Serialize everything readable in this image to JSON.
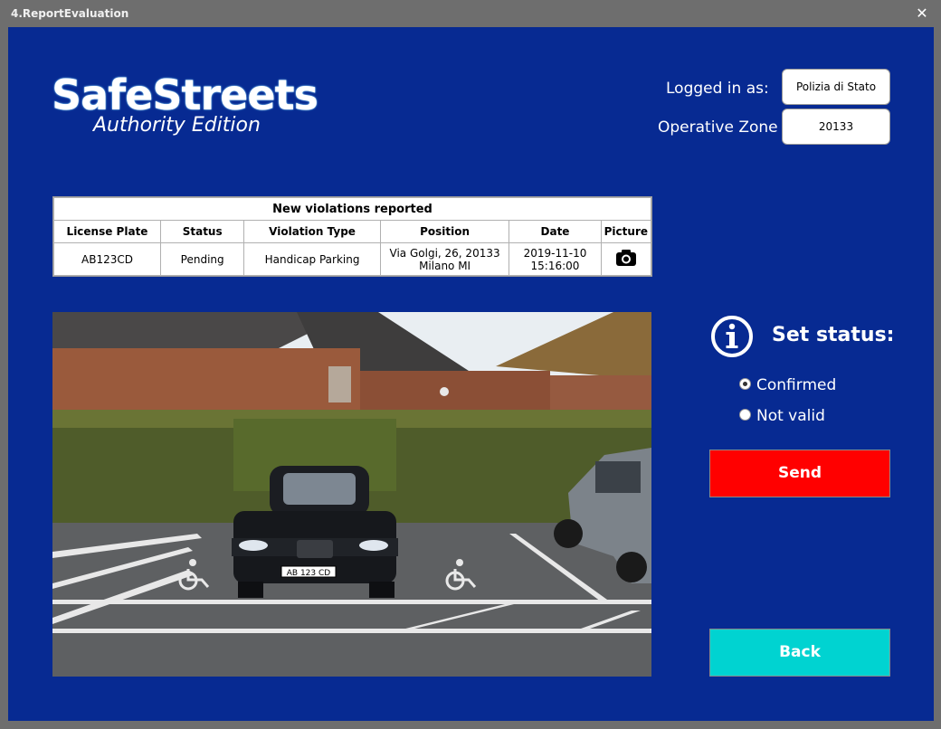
{
  "window": {
    "title": "4.ReportEvaluation",
    "close_glyph": "✕"
  },
  "logo": {
    "main": "SafeStreets",
    "sub": "Authority Edition"
  },
  "login": {
    "logged_label": "Logged in as:",
    "logged_value": "Polizia di Stato",
    "zone_label": "Operative Zone",
    "zone_value": "20133"
  },
  "table": {
    "caption": "New violations reported",
    "headers": [
      "License Plate",
      "Status",
      "Violation Type",
      "Position",
      "Date",
      "Picture"
    ],
    "row": {
      "plate": "AB123CD",
      "status": "Pending",
      "type": "Handicap Parking",
      "position_line1": "Via Golgi, 26, 20133",
      "position_line2": "Milano MI",
      "date_line1": "2019-11-10",
      "date_line2": "15:16:00",
      "picture_icon": "camera-icon"
    }
  },
  "photo": {
    "plate_text": "AB 123 CD"
  },
  "status_panel": {
    "title": "Set status:",
    "icon": "info-icon",
    "options": [
      {
        "label": "Confirmed",
        "selected": true
      },
      {
        "label": "Not valid",
        "selected": false
      }
    ]
  },
  "buttons": {
    "send": "Send",
    "back": "Back"
  },
  "colors": {
    "background": "#072a92",
    "send": "#ff0000",
    "back": "#00d3d1"
  }
}
